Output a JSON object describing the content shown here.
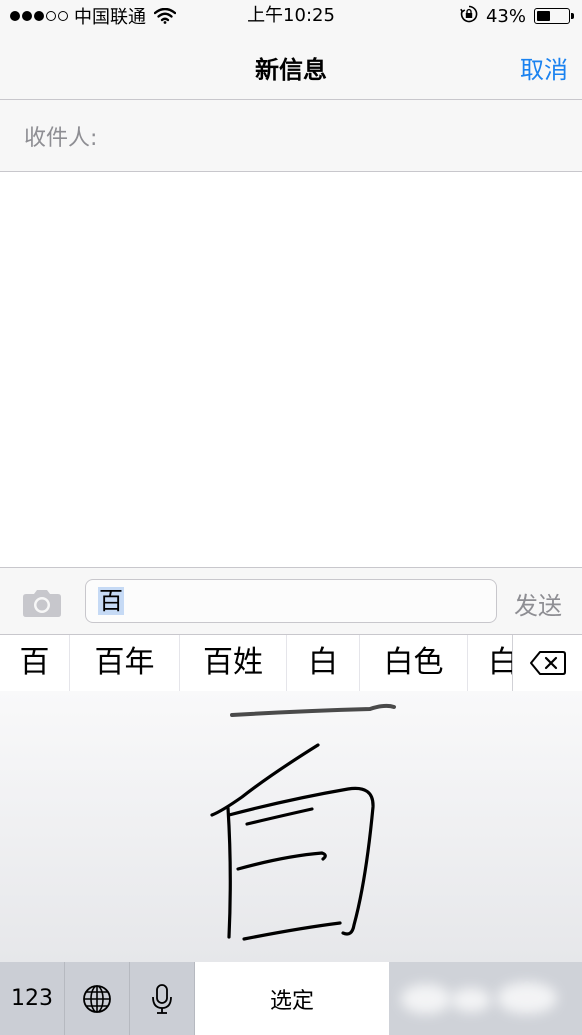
{
  "status_bar": {
    "carrier": "中国联通",
    "time": "上午10:25",
    "battery_percent": "43%",
    "battery_level": 0.43,
    "signal_bars_filled": 3,
    "signal_bars_total": 5
  },
  "nav": {
    "title": "新信息",
    "cancel_label": "取消"
  },
  "recipient": {
    "label": "收件人:"
  },
  "compose": {
    "text": "百",
    "send_label": "发送"
  },
  "candidates": [
    "百",
    "百年",
    "百姓",
    "白",
    "白色",
    "白"
  ],
  "keyboard": {
    "numbers_label": "123",
    "select_label": "选定"
  },
  "icons": {
    "wifi": "wifi-icon",
    "orientation_lock": "orientation-lock-icon",
    "battery": "battery-icon",
    "camera": "camera-icon",
    "delete": "delete-backspace-icon",
    "globe": "globe-icon",
    "microphone": "microphone-icon"
  },
  "colors": {
    "accent": "#1a82f0",
    "placeholder_gray": "#8e8e93",
    "selection": "#c6daf5"
  }
}
